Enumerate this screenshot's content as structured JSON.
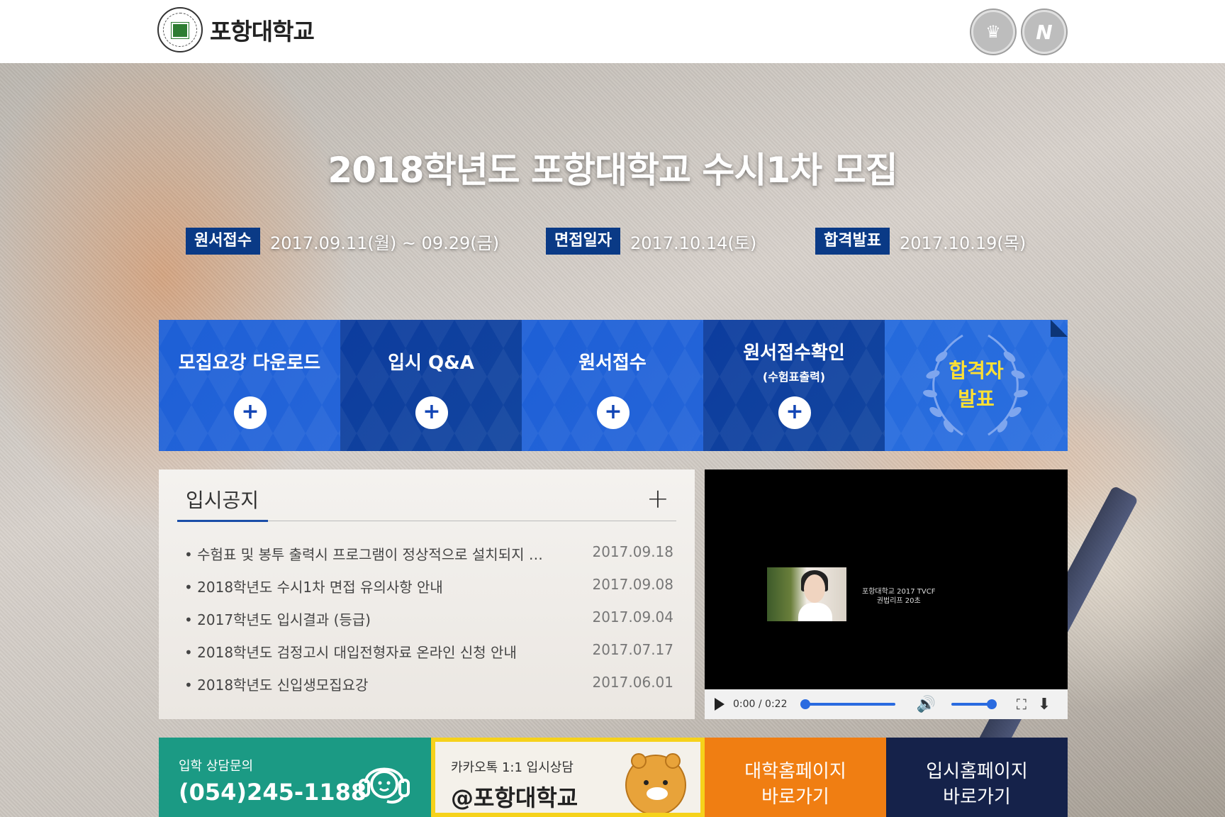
{
  "header": {
    "logo_text": "포항대학교",
    "badges": [
      "award-badge",
      "certification-badge"
    ]
  },
  "hero": {
    "title": "2018학년도 포항대학교 수시1차 모집",
    "dates": [
      {
        "tag": "원서접수",
        "value": "2017.09.11(월) ~ 09.29(금)"
      },
      {
        "tag": "면접일자",
        "value": "2017.10.14(토)"
      },
      {
        "tag": "합격발표",
        "value": "2017.10.19(목)"
      }
    ]
  },
  "tiles": [
    {
      "label": "모집요강 다운로드",
      "sub": ""
    },
    {
      "label": "입시 Q&A",
      "sub": ""
    },
    {
      "label": "원서접수",
      "sub": ""
    },
    {
      "label": "원서접수확인",
      "sub": "(수험표출력)"
    }
  ],
  "award_tile": {
    "line1": "합격자",
    "line2": "발표"
  },
  "plus_symbol": "+",
  "notice": {
    "title": "입시공지",
    "more": "+",
    "items": [
      {
        "title": "• 수험표 및 봉투 출력시 프로그램이 정상적으로 설치되지 …",
        "date": "2017.09.18"
      },
      {
        "title": "• 2018학년도 수시1차 면접 유의사항 안내",
        "date": "2017.09.08"
      },
      {
        "title": "• 2017학년도 입시결과 (등급)",
        "date": "2017.09.04"
      },
      {
        "title": "• 2018학년도 검정고시 대입전형자료 온라인 신청 안내",
        "date": "2017.07.17"
      },
      {
        "title": "• 2018학년도 신입생모집요강",
        "date": "2017.06.01"
      }
    ]
  },
  "video": {
    "caption_line1": "포항대학교 2017 TVCF",
    "caption_line2": "권법리프 20초",
    "time": "0:00 / 0:22",
    "progress": 0.0,
    "volume": 1.0
  },
  "bottom": {
    "consult": {
      "label": "입학 상담문의",
      "phone": "(054)245-1188"
    },
    "kakao": {
      "label": "카카오톡 1:1 입시상담",
      "id": "@포항대학교"
    },
    "univ_home": {
      "line1": "대학홈페이지",
      "line2": "바로가기"
    },
    "admission_home": {
      "line1": "입시홈페이지",
      "line2": "바로가기"
    }
  },
  "colors": {
    "navy": "#0a3a86",
    "tile_blue": "#1d5fd6",
    "green": "#1b9a84",
    "orange": "#f07e12",
    "kakao_yellow": "#f6d21b",
    "dark_navy": "#15224a"
  }
}
